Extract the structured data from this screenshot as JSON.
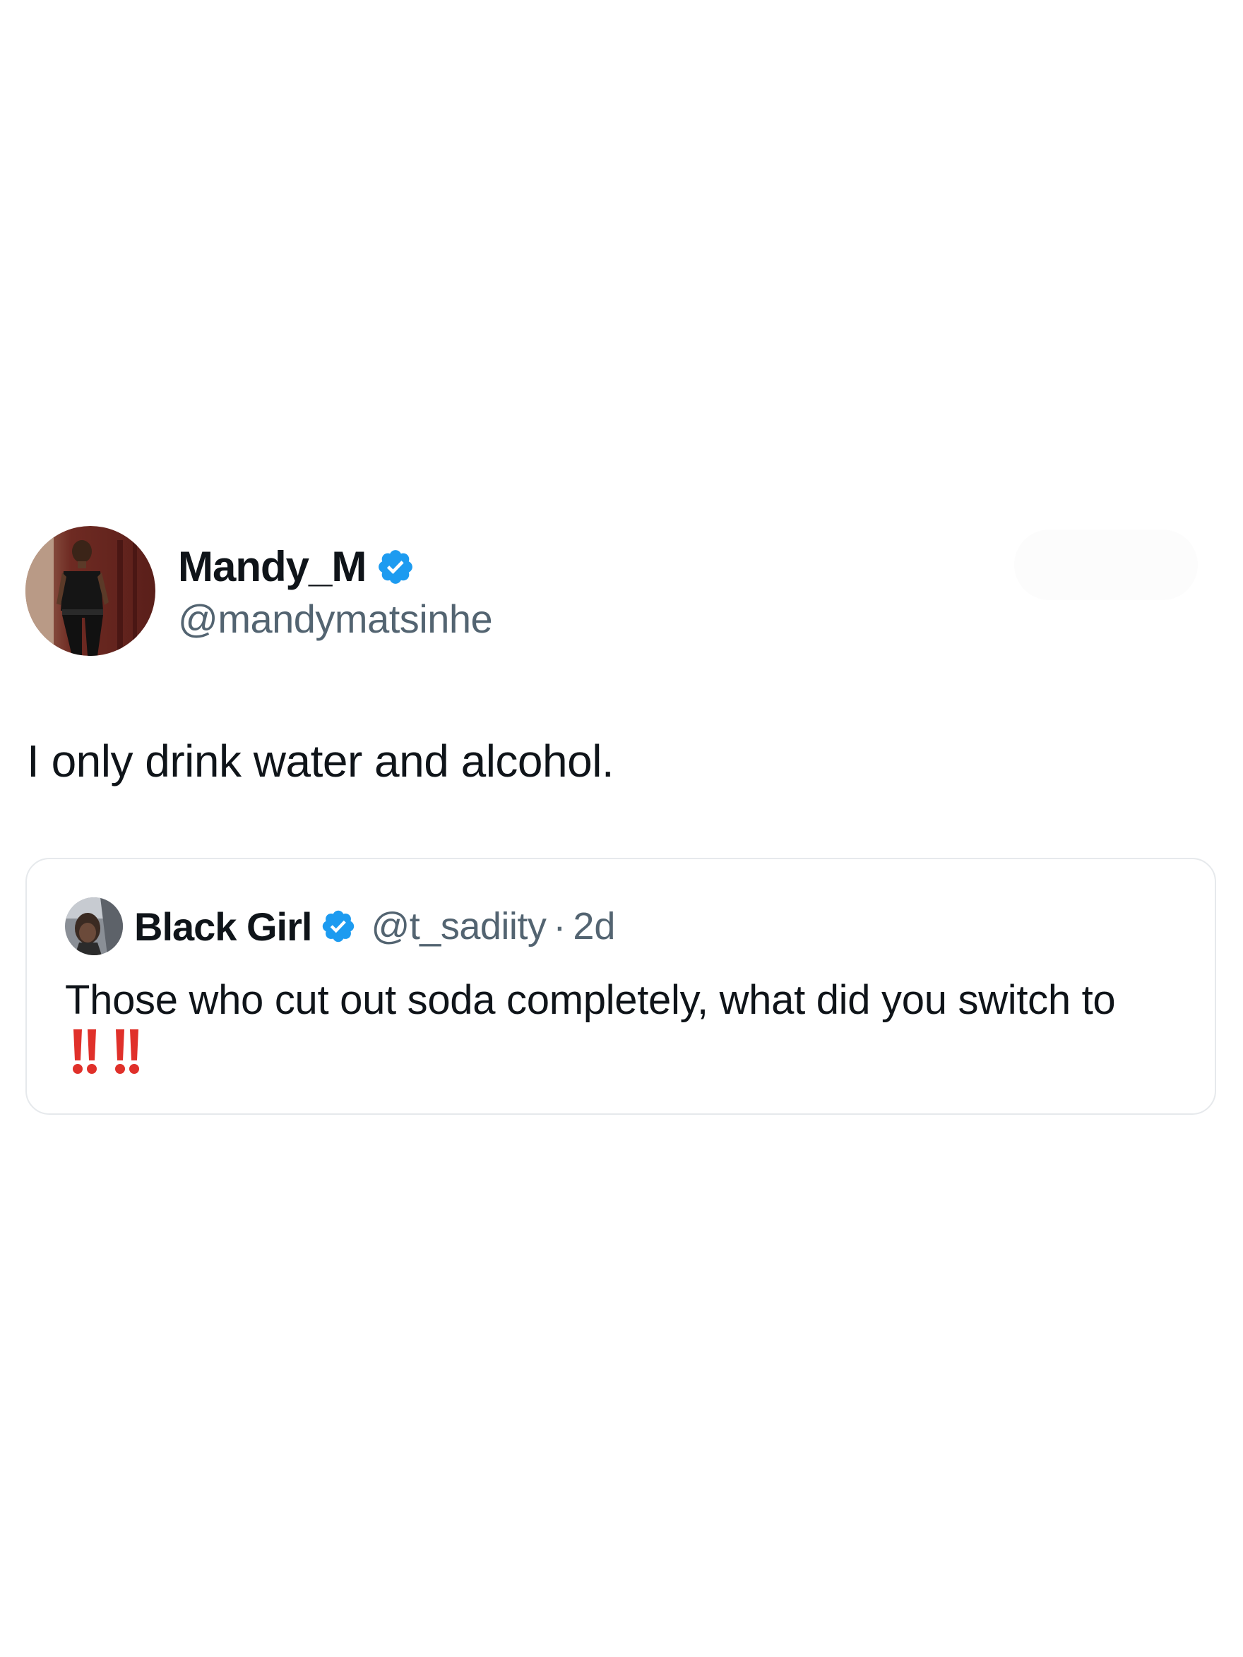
{
  "tweet": {
    "author": {
      "display_name": "Mandy_M",
      "handle": "@mandymatsinhe",
      "verified": true
    },
    "text": "I only drink water and alcohol.",
    "quoted_tweet": {
      "author": {
        "display_name": "Black Girl",
        "handle": "@t_sadiity",
        "verified": true
      },
      "separator": "·",
      "time": "2d",
      "text_before_emoji": "Those who cut out soda completely, what did you switch to",
      "emoji": "‼️‼️"
    }
  },
  "colors": {
    "text_primary": "#0f1419",
    "text_secondary": "#536471",
    "verified_blue": "#1d9bf0",
    "border": "#e6e9ec",
    "emoji_red": "#e0302a"
  },
  "icons": {
    "verified": "verified-badge-icon",
    "emoji": "double-exclamation-emoji"
  }
}
